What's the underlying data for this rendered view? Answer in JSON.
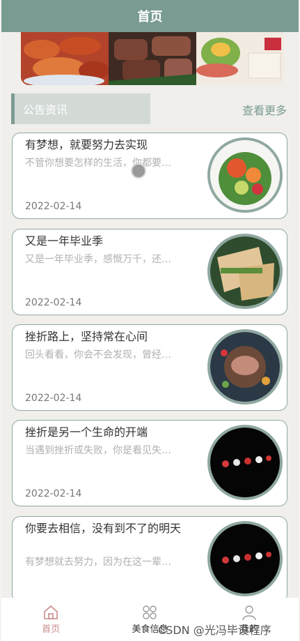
{
  "header": {
    "title": "首页"
  },
  "notice": {
    "section_title": "公告资讯",
    "more_label": "查看更多"
  },
  "articles": [
    {
      "title": "有梦想，就要努力去实现",
      "summary": "不管你想要怎样的生活，你都要…",
      "date": "2022-02-14"
    },
    {
      "title": "又是一年毕业季",
      "summary": "又是一年毕业季，感慨万千，还…",
      "date": "2022-02-14"
    },
    {
      "title": "挫折路上，坚持常在心间",
      "summary": "回头看看，你会不会发现，曾经…",
      "date": "2022-02-14"
    },
    {
      "title": "挫折是另一个生命的开端",
      "summary": "当遇到挫折或失败，你是看见失…",
      "date": "2022-02-14"
    },
    {
      "title": "你要去相信，没有到不了的明天",
      "summary": "有梦想就去努力，因为在这一辈…",
      "date": ""
    }
  ],
  "tabbar": {
    "items": [
      {
        "label": "首页"
      },
      {
        "label": "美食信息"
      },
      {
        "label": "我的"
      }
    ]
  },
  "watermark": "CSDN @光冯毕设程序",
  "colors": {
    "primary": "#7a9b92",
    "active_tab": "#c98b8b"
  }
}
